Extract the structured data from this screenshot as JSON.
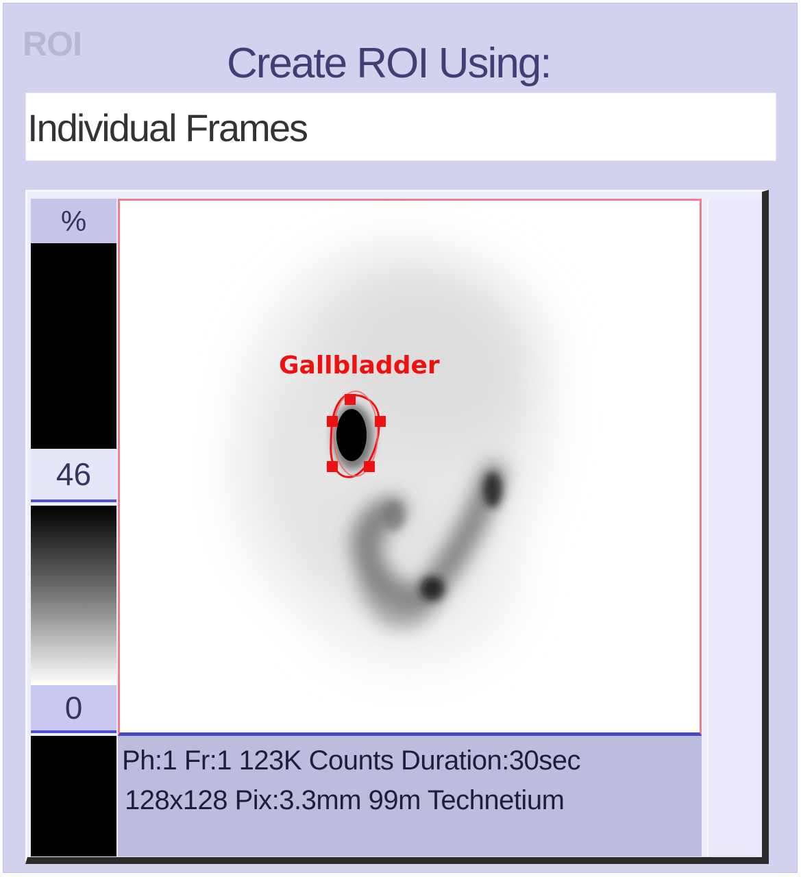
{
  "panel": {
    "title": "ROI",
    "heading": "Create ROI Using:"
  },
  "roi_method": {
    "selected": "Individual Frames"
  },
  "colorbar": {
    "unit_label": "%",
    "max_label": "46",
    "min_label": "0"
  },
  "image": {
    "roi_label": "Gallbladder",
    "roi_color": "#ee1111",
    "frame_border_color": "#ee7f8c"
  },
  "info": {
    "line1": "Ph:1 Fr:1 123K Counts Duration:30sec",
    "line2": "128x128 Pix:3.3mm 99m Technetium"
  },
  "colors": {
    "panel_bg": "#d2d2ee",
    "heading": "#3f3f74",
    "info_bg": "#bcbcde"
  }
}
